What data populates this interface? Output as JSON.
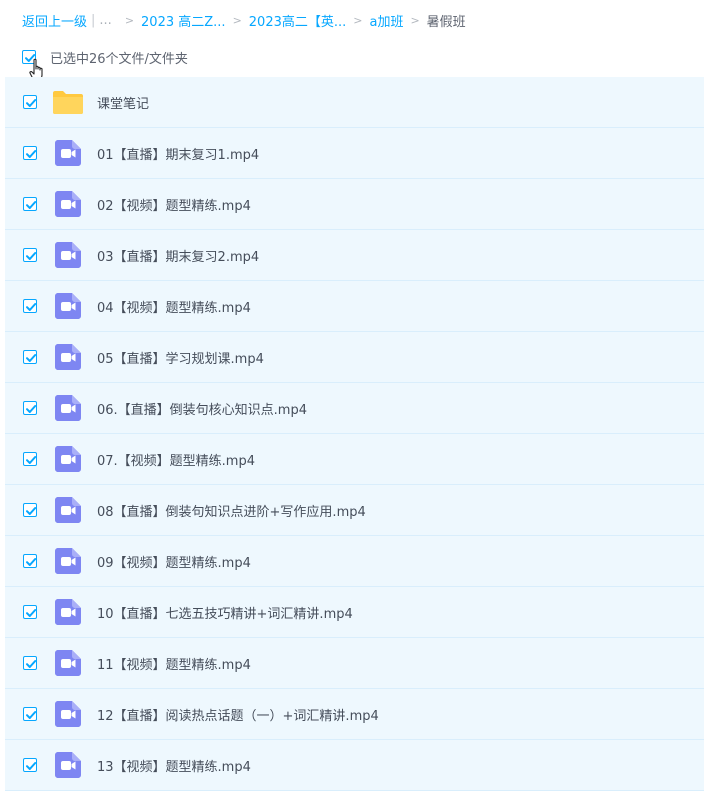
{
  "breadcrumb": {
    "back": "返回上一级",
    "bar": "|",
    "ellipsis": "...",
    "arrow": ">",
    "items": [
      "2023 高二Z...",
      "2023高二【英...",
      "a加班"
    ],
    "current": "暑假班"
  },
  "selection": {
    "text": "已选中26个文件/文件夹"
  },
  "icons": {
    "checkbox": "checkbox-checked-icon",
    "folder": "folder-icon",
    "video": "video-file-icon",
    "cursor": "hand-pointer-icon"
  },
  "colors": {
    "accent": "#06a7ff",
    "row_bg": "#eef8fe",
    "folder": "#ffc940",
    "video": "#7e86f2"
  },
  "files": [
    {
      "name": "课堂笔记",
      "type": "folder"
    },
    {
      "name": "01【直播】期末复习1.mp4",
      "type": "video"
    },
    {
      "name": "02【视频】题型精练.mp4",
      "type": "video"
    },
    {
      "name": "03【直播】期末复习2.mp4",
      "type": "video"
    },
    {
      "name": "04【视频】题型精练.mp4",
      "type": "video"
    },
    {
      "name": "05【直播】学习规划课.mp4",
      "type": "video"
    },
    {
      "name": "06.【直播】倒装句核心知识点.mp4",
      "type": "video"
    },
    {
      "name": "07.【视频】题型精练.mp4",
      "type": "video"
    },
    {
      "name": "08【直播】倒装句知识点进阶+写作应用.mp4",
      "type": "video"
    },
    {
      "name": "09【视频】题型精练.mp4",
      "type": "video"
    },
    {
      "name": "10【直播】七选五技巧精讲+词汇精讲.mp4",
      "type": "video"
    },
    {
      "name": "11【视频】题型精练.mp4",
      "type": "video"
    },
    {
      "name": "12【直播】阅读热点话题（一）+词汇精讲.mp4",
      "type": "video"
    },
    {
      "name": "13【视频】题型精练.mp4",
      "type": "video"
    }
  ]
}
